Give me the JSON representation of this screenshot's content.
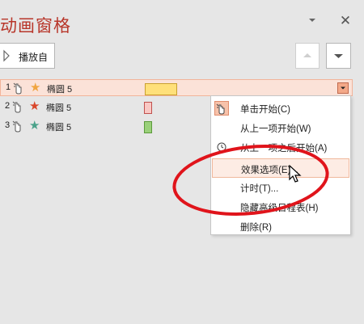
{
  "pane": {
    "title": "动画窗格",
    "play_label": "播放自"
  },
  "animations": [
    {
      "num": "1",
      "name": "椭圆 5",
      "star_color": "#f0a540",
      "bar_color": "#ffe07a",
      "bar_border": "#c9a030",
      "selected": true
    },
    {
      "num": "2",
      "name": "椭圆 5",
      "star_color": "#d9462a",
      "bar_color": "#f9c8c4",
      "bar_border": "#c0504d",
      "selected": false
    },
    {
      "num": "3",
      "name": "椭圆 5",
      "star_color": "#4aa28a",
      "bar_color": "#9ad07a",
      "bar_border": "#5b9a3a",
      "selected": false
    }
  ],
  "context_menu": {
    "items": [
      {
        "label": "单击开始(C)"
      },
      {
        "label": "从上一项开始(W)"
      },
      {
        "label": "从上一项之后开始(A)"
      },
      {
        "label": "效果选项(E)..."
      },
      {
        "label": "计时(T)..."
      },
      {
        "label": "隐藏高级日程表(H)"
      },
      {
        "label": "删除(R)"
      }
    ]
  },
  "colors": {
    "accent": "#b8362a",
    "annotation_ellipse": "#e0141b",
    "selection": "#fbe2d8"
  }
}
